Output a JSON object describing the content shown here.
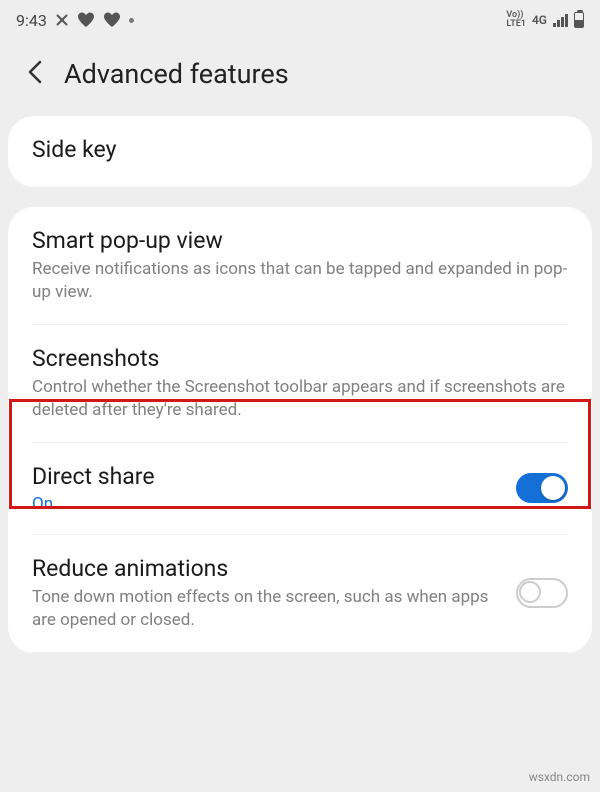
{
  "statusbar": {
    "time": "9:43",
    "net1": "Vo))",
    "net2": "LTE1",
    "net3": "4G"
  },
  "header": {
    "title": "Advanced features"
  },
  "card1": {
    "sideKey": {
      "title": "Side key"
    }
  },
  "card2": {
    "smartPopup": {
      "title": "Smart pop-up view",
      "desc": "Receive notifications as icons that can be tapped and expanded in pop-up view."
    },
    "screenshots": {
      "title": "Screenshots",
      "desc": "Control whether the Screenshot toolbar appears and if screenshots are deleted after they're shared."
    },
    "directShare": {
      "title": "Direct share",
      "status": "On",
      "toggle": true
    },
    "reduceAnimations": {
      "title": "Reduce animations",
      "desc": "Tone down motion effects on the screen, such as when apps are opened or closed.",
      "toggle": false
    }
  },
  "watermark": "wsxdn.com"
}
